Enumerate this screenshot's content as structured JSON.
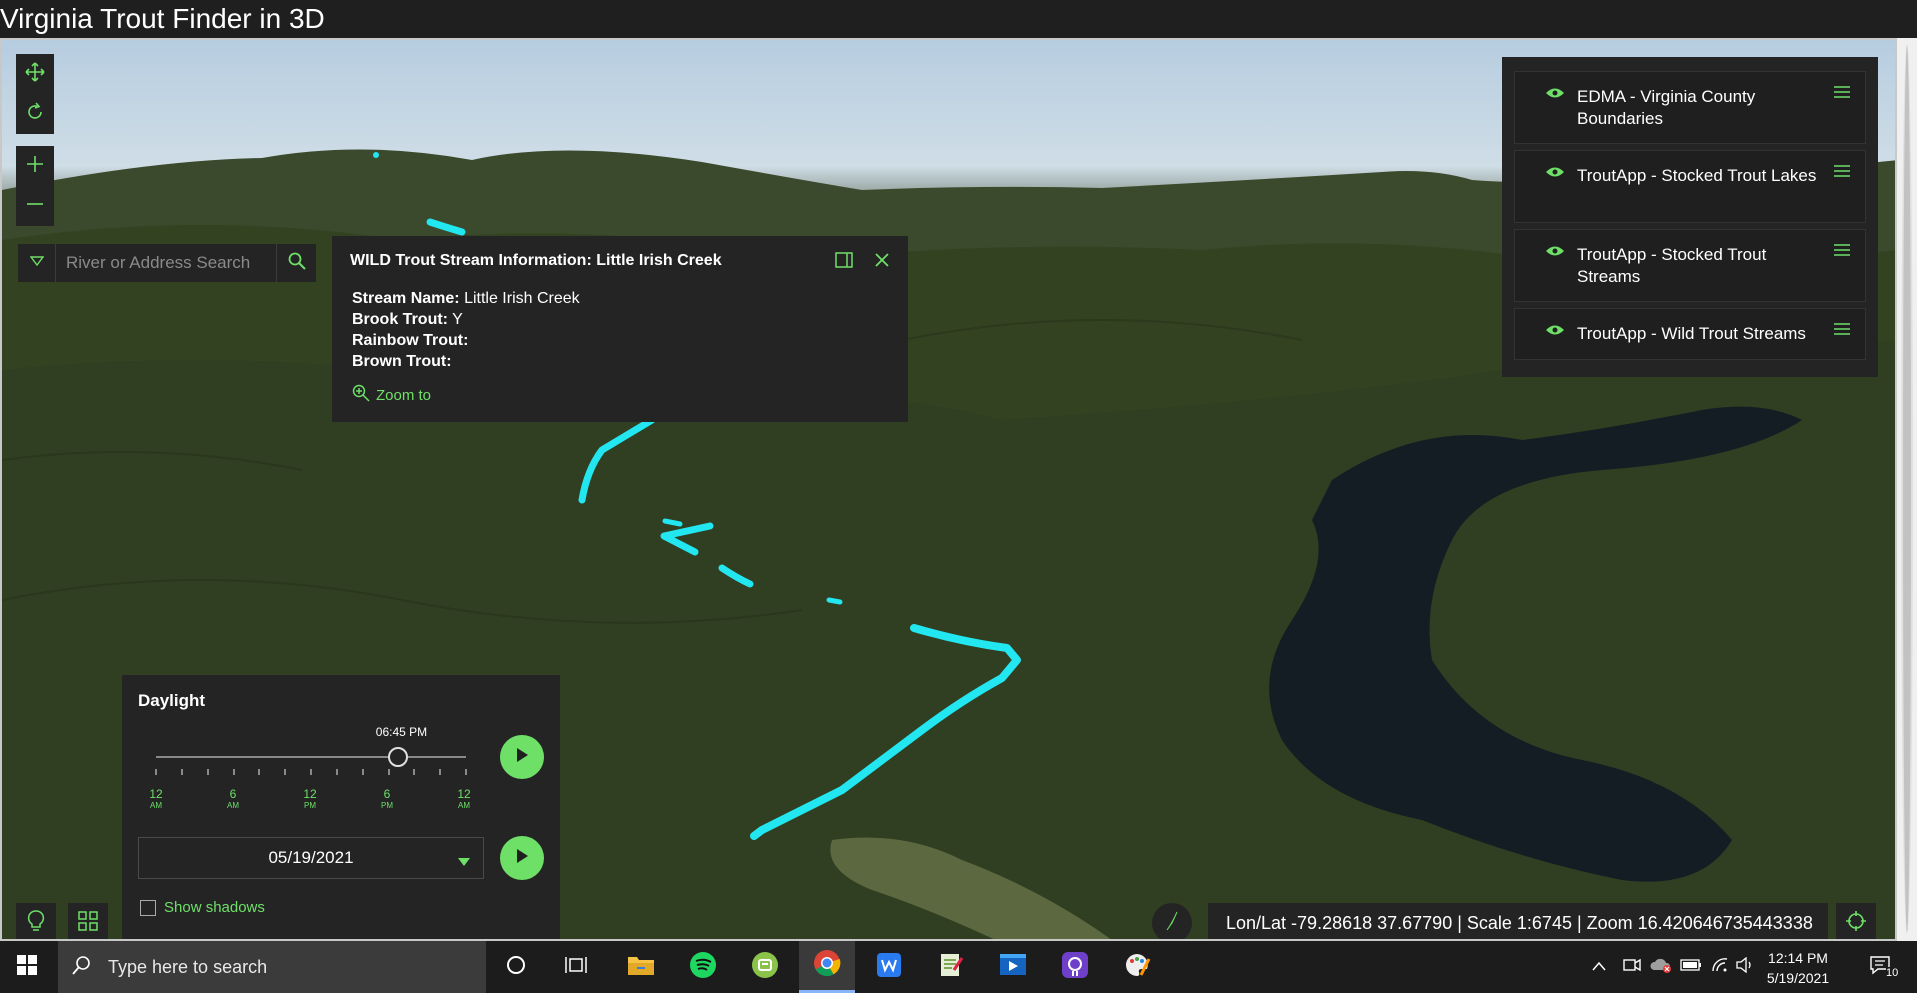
{
  "window": {
    "title": "Virginia Trout Finder in 3D"
  },
  "search": {
    "placeholder": "River or Address Search"
  },
  "popup": {
    "title": "WILD Trout Stream Information: Little Irish Creek",
    "fields": [
      {
        "label": "Stream Name:",
        "value": "Little Irish Creek"
      },
      {
        "label": "Brook Trout:",
        "value": "Y"
      },
      {
        "label": "Rainbow Trout:",
        "value": ""
      },
      {
        "label": "Brown Trout:",
        "value": ""
      }
    ],
    "zoom_label": "Zoom to"
  },
  "layers": [
    {
      "name": "EDMA - Virginia County Boundaries"
    },
    {
      "name": "TroutApp - Stocked Trout Lakes"
    },
    {
      "name": "TroutApp - Stocked Trout Streams"
    },
    {
      "name": "TroutApp - Wild Trout Streams"
    }
  ],
  "daylight": {
    "title": "Daylight",
    "time": "06:45 PM",
    "time_fraction": 0.78,
    "ticks": [
      {
        "num": "12",
        "ampm": "AM"
      },
      {
        "num": "6",
        "ampm": "AM"
      },
      {
        "num": "12",
        "ampm": "PM"
      },
      {
        "num": "6",
        "ampm": "PM"
      },
      {
        "num": "12",
        "ampm": "AM"
      }
    ],
    "date": "05/19/2021",
    "shadows_label": "Show shadows",
    "shadows_checked": false
  },
  "status": {
    "text": "Lon/Lat -79.28618 37.67790 | Scale 1:6745 | Zoom 16.420646735443338"
  },
  "taskbar": {
    "search_placeholder": "Type here to search",
    "time": "12:14 PM",
    "date": "5/19/2021",
    "notifications": "10"
  },
  "colors": {
    "accent": "#6ee068",
    "stream": "#22e6f0",
    "panel": "#242424"
  }
}
